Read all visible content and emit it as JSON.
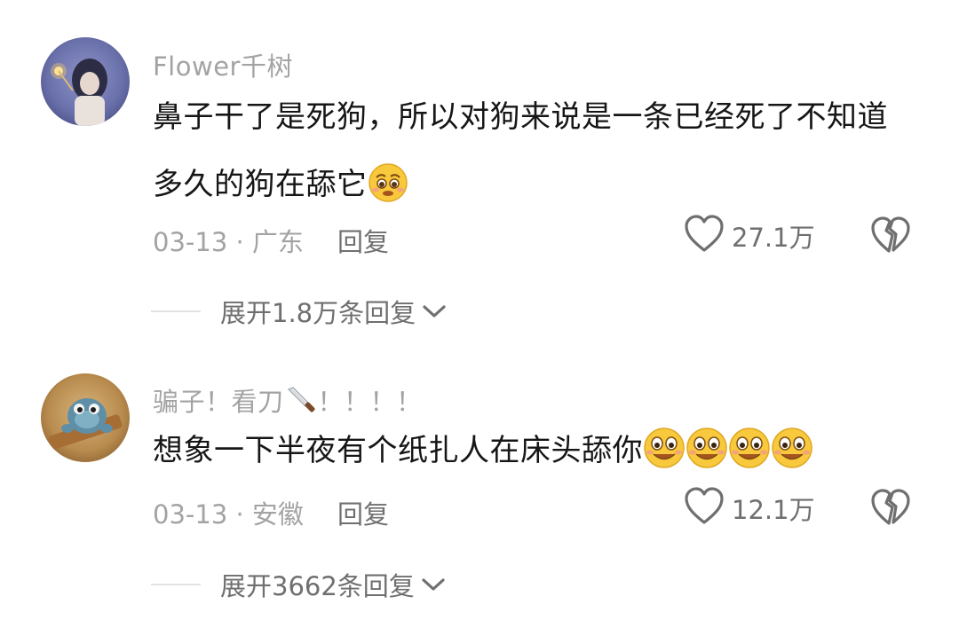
{
  "comments": [
    {
      "username": "Flower千树",
      "text_line1": "鼻子干了是死狗，所以对狗来说是一条已经死了不知道",
      "text_line2": "多久的狗在舔它",
      "text_emoji": "pleading-face-emoji",
      "date_location": "03-13 · 广东",
      "reply_label": "回复",
      "likes": "27.1万",
      "expand_label": "展开1.8万条回复"
    },
    {
      "username_prefix": "骗子！看刀",
      "username_suffix": "！！！！",
      "username_icon": "knife-emoji",
      "text": "想象一下半夜有个纸扎人在床头舔你",
      "text_emoji": "grinning-face-emoji",
      "text_emoji_count": 4,
      "date_location": "03-13 · 安徽",
      "reply_label": "回复",
      "likes": "12.1万",
      "expand_label": "展开3662条回复"
    }
  ],
  "icons": {
    "like": "heart-outline-icon",
    "dislike": "broken-heart-icon",
    "expand": "chevron-down-icon"
  },
  "colors": {
    "username": "#a3a3a3",
    "text": "#161616",
    "secondary": "#6f6f6f",
    "emoji_yellow": "#f8c93c"
  }
}
